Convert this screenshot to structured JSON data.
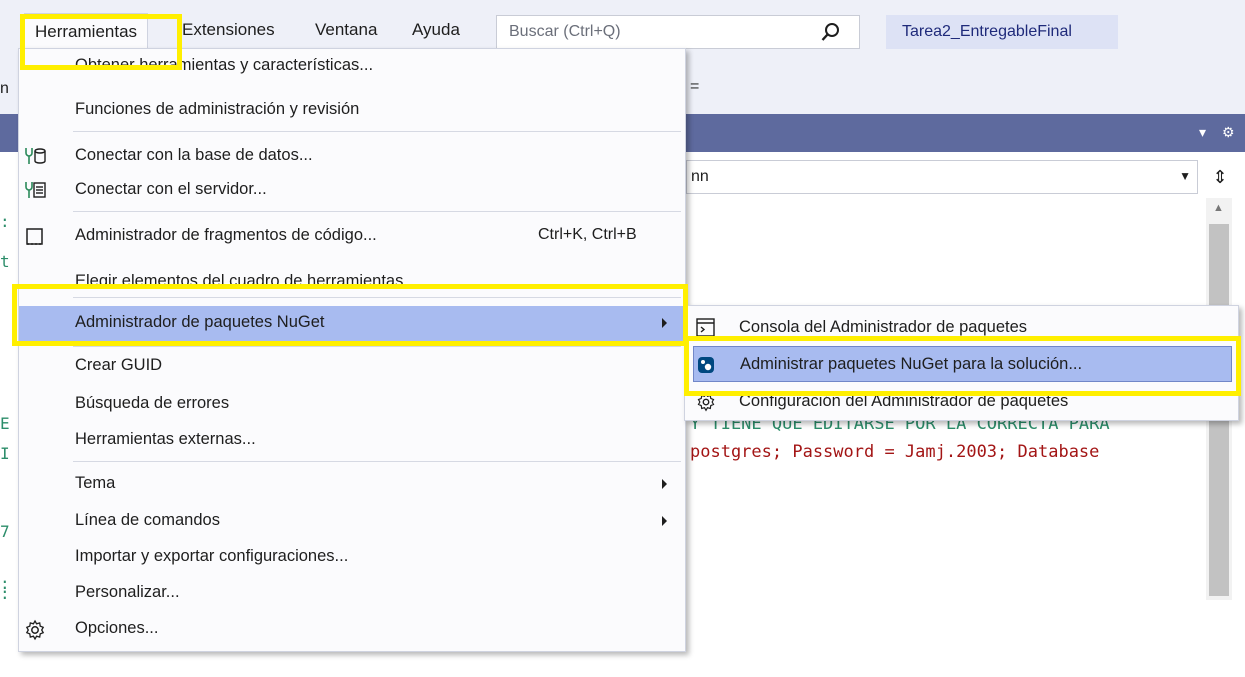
{
  "menubar": {
    "items": [
      "Herramientas",
      "Extensiones",
      "Ventana",
      "Ayuda"
    ],
    "search_placeholder": "Buscar (Ctrl+Q)",
    "project_name": "Tarea2_EntregableFinal"
  },
  "toolbar": {
    "left_fragment": "n",
    "dropdown_glyph": "="
  },
  "editor": {
    "combo_value": "nn",
    "code_line_green": "Y TIENE QUE EDITARSE POR LA CORRECTA PARA",
    "code_line_red": "postgres; Password = Jamj.2003; Database",
    "left_fragments": [
      ":",
      "t",
      "E",
      "I",
      "7",
      ":",
      ":"
    ]
  },
  "herramientas_menu": {
    "items": [
      {
        "label": "Obtener herramientas y características...",
        "shortcut": "",
        "submenu": false,
        "icon": ""
      },
      {
        "label": "Funciones de administración y revisión",
        "shortcut": "",
        "submenu": false,
        "icon": ""
      },
      {
        "label": "Conectar con la base de datos...",
        "shortcut": "",
        "submenu": false,
        "icon": "database-plug-icon"
      },
      {
        "label": "Conectar con el servidor...",
        "shortcut": "",
        "submenu": false,
        "icon": "server-plug-icon"
      },
      {
        "label": "Administrador de fragmentos de código...",
        "shortcut": "Ctrl+K, Ctrl+B",
        "submenu": false,
        "icon": "snippet-icon"
      },
      {
        "label": "Elegir elementos del cuadro de herramientas...",
        "shortcut": "",
        "submenu": false,
        "icon": ""
      },
      {
        "label": "Administrador de paquetes NuGet",
        "shortcut": "",
        "submenu": true,
        "icon": ""
      },
      {
        "label": "Crear GUID",
        "shortcut": "",
        "submenu": false,
        "icon": ""
      },
      {
        "label": "Búsqueda de errores",
        "shortcut": "",
        "submenu": false,
        "icon": ""
      },
      {
        "label": "Herramientas externas...",
        "shortcut": "",
        "submenu": false,
        "icon": ""
      },
      {
        "label": "Tema",
        "shortcut": "",
        "submenu": true,
        "icon": ""
      },
      {
        "label": "Línea de comandos",
        "shortcut": "",
        "submenu": true,
        "icon": ""
      },
      {
        "label": "Importar y exportar configuraciones...",
        "shortcut": "",
        "submenu": false,
        "icon": ""
      },
      {
        "label": "Personalizar...",
        "shortcut": "",
        "submenu": false,
        "icon": ""
      },
      {
        "label": "Opciones...",
        "shortcut": "",
        "submenu": false,
        "icon": "gear-icon"
      }
    ]
  },
  "nuget_submenu": {
    "items": [
      {
        "label": "Consola del Administrador de paquetes",
        "icon": "console-icon"
      },
      {
        "label": "Administrar paquetes NuGet para la solución...",
        "icon": "nuget-icon"
      },
      {
        "label": "Configuración del Administrador de paquetes",
        "icon": "gear-icon"
      }
    ]
  },
  "colors": {
    "highlight": "#a8bbf0",
    "annotation": "#ffef00",
    "header": "#5e6a9e"
  }
}
